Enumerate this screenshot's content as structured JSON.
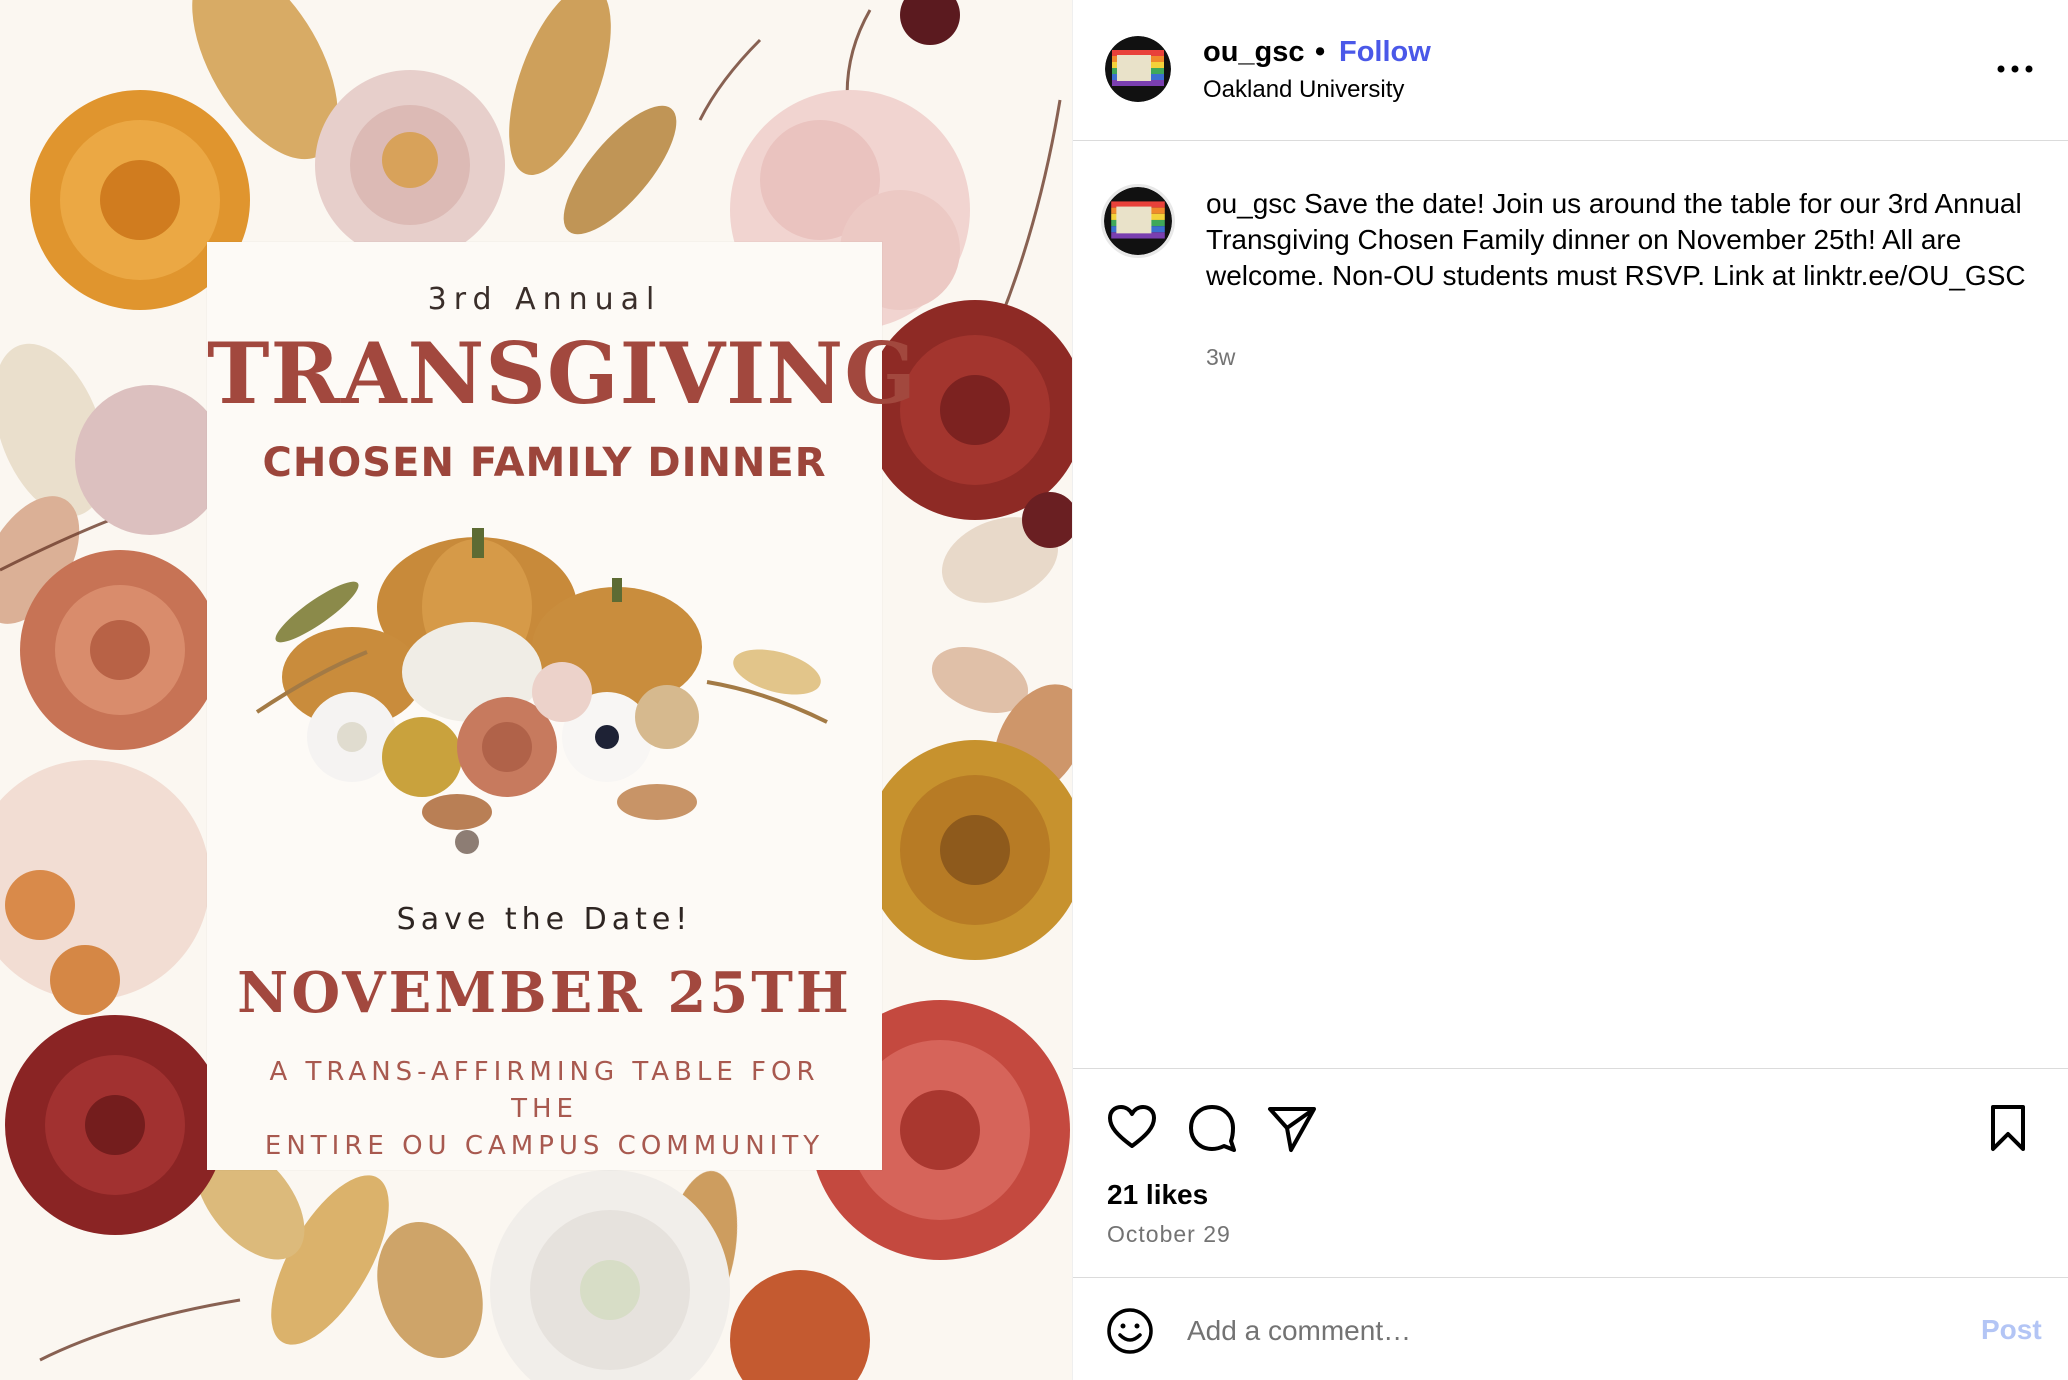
{
  "post_image": {
    "annual": "3rd Annual",
    "headline": "TRANSGIVING",
    "subhead": "CHOSEN FAMILY DINNER",
    "save_the_date": "Save the Date!",
    "event_date": "NOVEMBER 25TH",
    "tagline_line1": "A TRANS-AFFIRMING TABLE FOR THE",
    "tagline_line2": "ENTIRE OU CAMPUS COMMUNITY"
  },
  "header": {
    "username": "ou_gsc",
    "separator": "•",
    "follow_label": "Follow",
    "location": "Oakland University",
    "more_icon": "more-horizontal-icon"
  },
  "caption": {
    "username": "ou_gsc",
    "text": "Save the date! Join us around the table for our 3rd Annual Transgiving Chosen Family dinner on November 25th! All are welcome. Non-OU students must RSVP. Link at linktr.ee/OU_GSC",
    "time_ago": "3w"
  },
  "actions": {
    "like_icon": "heart-icon",
    "comment_icon": "comment-icon",
    "share_icon": "share-icon",
    "save_icon": "bookmark-icon",
    "likes": "21 likes",
    "date": "October 29"
  },
  "comment": {
    "emoji_icon": "emoji-icon",
    "placeholder": "Add a comment…",
    "post_label": "Post"
  },
  "colors": {
    "follow": "#4a58e8",
    "post_disabled": "#b3c5f5",
    "muted_text": "#737373",
    "divider": "#dbdbdb",
    "headline_rust": "#a2483e"
  }
}
